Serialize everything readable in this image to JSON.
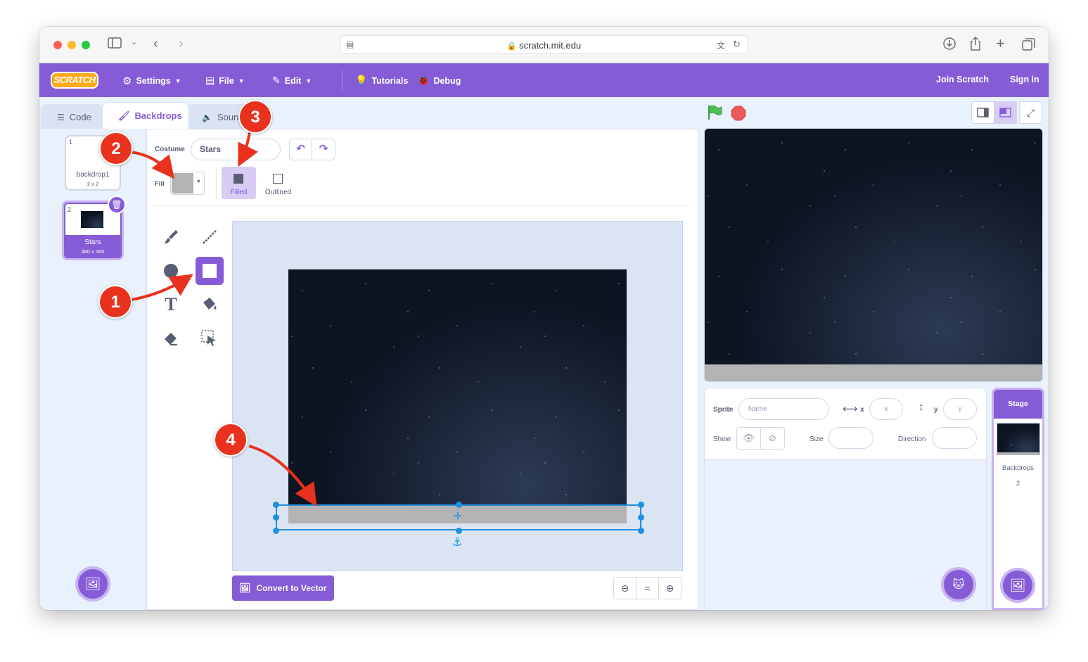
{
  "browser": {
    "url": "scratch.mit.edu"
  },
  "menubar": {
    "logo": "SCRATCH",
    "settings": "Settings",
    "file": "File",
    "edit": "Edit",
    "tutorials": "Tutorials",
    "debug": "Debug",
    "join": "Join Scratch",
    "signin": "Sign in"
  },
  "tabs": {
    "code": "Code",
    "backdrops": "Backdrops",
    "sounds": "Sounds"
  },
  "costumes": [
    {
      "index": "1",
      "name": "backdrop1",
      "size": "2 x 2"
    },
    {
      "index": "2",
      "name": "Stars",
      "size": "480 x 360"
    }
  ],
  "editor": {
    "costume_label": "Costume",
    "costume_name": "Stars",
    "fill_label": "Fill",
    "fill_color": "#b3b3b3",
    "filled_label": "Filled",
    "outlined_label": "Outlined",
    "convert_button": "Convert to Vector",
    "zoom_reset": "="
  },
  "annotations": [
    "1",
    "2",
    "3",
    "4"
  ],
  "sprite_info": {
    "sprite_label": "Sprite",
    "name_placeholder": "Name",
    "x_label": "x",
    "x_placeholder": "x",
    "y_label": "y",
    "y_placeholder": "y",
    "show_label": "Show",
    "size_label": "Size",
    "direction_label": "Direction"
  },
  "stage_panel": {
    "title": "Stage",
    "backdrops_label": "Backdrops",
    "backdrops_count": "2"
  },
  "colors": {
    "scratch_purple": "#855cd6",
    "marker_red": "#e8321e",
    "selection_blue": "#1e90e0"
  }
}
